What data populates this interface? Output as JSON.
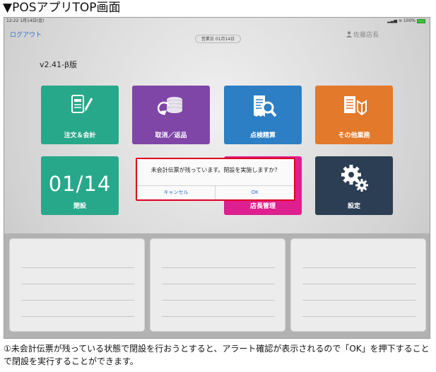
{
  "heading": "▼POSアプリTOP画面",
  "status": {
    "time": "12:22  1月14日(金)",
    "right": "100%"
  },
  "nav": {
    "logout": "ログアウト",
    "date": "営業日 01月14日",
    "user": "佐藤店長"
  },
  "version": "v2.41-β版",
  "tiles": [
    {
      "label": "注文＆会計",
      "color": "#28a88a",
      "icon": "order-pad-icon"
    },
    {
      "label": "取消／返品",
      "color": "#7f46a8",
      "icon": "coin-return-icon"
    },
    {
      "label": "点検精算",
      "color": "#2c7fc4",
      "icon": "receipt-magnifier-icon"
    },
    {
      "label": "その他業務",
      "color": "#e2792b",
      "icon": "document-beginner-icon"
    },
    {
      "label": "閉設",
      "date": "01/14",
      "color": "#28a88a"
    },
    {
      "label": "店長管理",
      "color": "#de1f8f"
    },
    {
      "label": "設定",
      "color": "#2c3e53",
      "icon": "gears-icon"
    }
  ],
  "dialog": {
    "message": "未会計伝票が残っています。閉設を実施しますか？",
    "cancel": "キャンセル",
    "ok": "OK",
    "highlight_color": "#e0001e"
  },
  "caption": "①未会計伝票が残っている状態で閉設を行おうとすると、アラート確認が表示されるので「OK」を押下することで閉設を実行することができます。"
}
